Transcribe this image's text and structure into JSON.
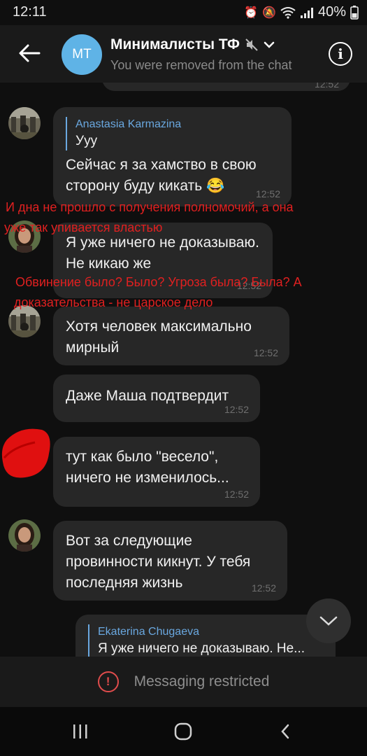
{
  "status_bar": {
    "time": "12:11",
    "battery": "40%"
  },
  "header": {
    "avatar_initials": "MT",
    "title": "Минималисты ТФ",
    "subtitle": "You were removed from the chat"
  },
  "messages": [
    {
      "reply_name": "Anastasia Karmazina",
      "reply_text": "Ууу",
      "text": "Сейчас я за хамство в свою сторону буду кикать 😂",
      "time": "12:52"
    },
    {
      "text": "Я уже ничего не доказываю. Не кикаю же",
      "time": "12:52"
    },
    {
      "text": "Хотя человек максимально мирный",
      "time": "12:52"
    },
    {
      "text": "Даже Маша подтвердит",
      "time": "12:52"
    },
    {
      "text": "тут как было \"весело\", ничего не изменилось...",
      "time": "12:52"
    },
    {
      "text": "Вот за следующие провинности кикнут. У тебя последняя жизнь",
      "time": "12:52"
    },
    {
      "reply_name": "Ekaterina Chugaeva",
      "reply_text": "Я уже ничего не доказываю. Не..."
    }
  ],
  "top_partial_time": "12:52",
  "annotations": [
    "И дна не прошло с получения полномочий, а она уже так упивается властью",
    "Обвинение было? Было? Угроза была? Была? А доказательства - не царское дело"
  ],
  "annotation_lines": [
    "И дна не прошло с получения полномочий, а она",
    "уже так упивается властью",
    "Обвинение было? Было? Угроза была? Была? А",
    "доказательства - не царское дело"
  ],
  "footer": {
    "restricted_label": "Messaging restricted"
  },
  "colors": {
    "accent": "#5fb3e6",
    "reply_accent": "#6aa8e0",
    "annotation": "#e02020",
    "warning": "#e04c4c"
  }
}
